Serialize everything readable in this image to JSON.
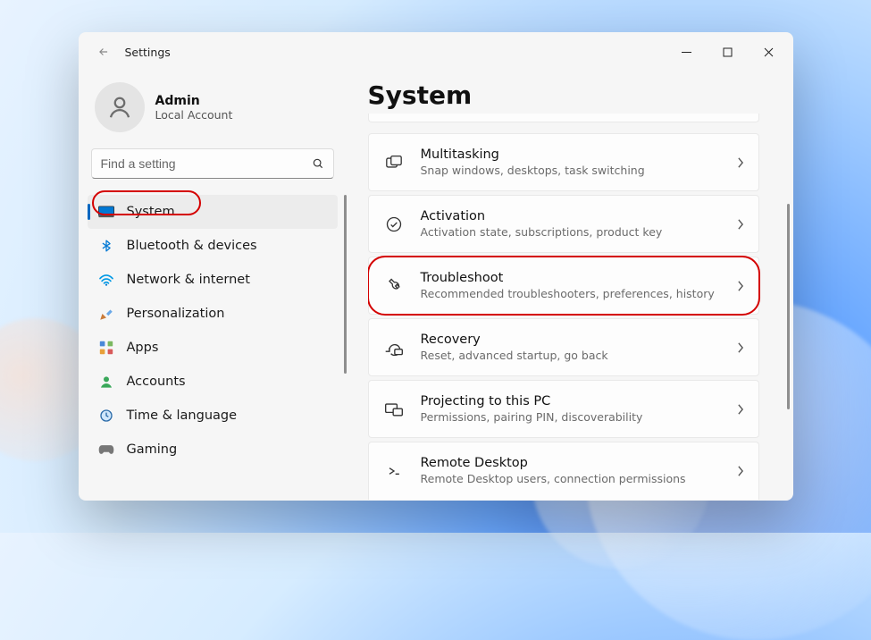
{
  "titlebar": {
    "title": "Settings"
  },
  "user": {
    "name": "Admin",
    "sub": "Local Account"
  },
  "search": {
    "placeholder": "Find a setting"
  },
  "nav": {
    "items": [
      {
        "id": "system",
        "label": "System"
      },
      {
        "id": "bluetooth",
        "label": "Bluetooth & devices"
      },
      {
        "id": "network",
        "label": "Network & internet"
      },
      {
        "id": "personalization",
        "label": "Personalization"
      },
      {
        "id": "apps",
        "label": "Apps"
      },
      {
        "id": "accounts",
        "label": "Accounts"
      },
      {
        "id": "time",
        "label": "Time & language"
      },
      {
        "id": "gaming",
        "label": "Gaming"
      }
    ],
    "active": "system"
  },
  "page": {
    "title": "System"
  },
  "cards": {
    "items": [
      {
        "id": "multitasking",
        "title": "Multitasking",
        "sub": "Snap windows, desktops, task switching"
      },
      {
        "id": "activation",
        "title": "Activation",
        "sub": "Activation state, subscriptions, product key"
      },
      {
        "id": "troubleshoot",
        "title": "Troubleshoot",
        "sub": "Recommended troubleshooters, preferences, history",
        "highlight": true
      },
      {
        "id": "recovery",
        "title": "Recovery",
        "sub": "Reset, advanced startup, go back"
      },
      {
        "id": "projecting",
        "title": "Projecting to this PC",
        "sub": "Permissions, pairing PIN, discoverability"
      },
      {
        "id": "remotedesktop",
        "title": "Remote Desktop",
        "sub": "Remote Desktop users, connection permissions"
      }
    ]
  },
  "annotations": {
    "sidebar_system_circled": true,
    "troubleshoot_card_circled": true
  }
}
